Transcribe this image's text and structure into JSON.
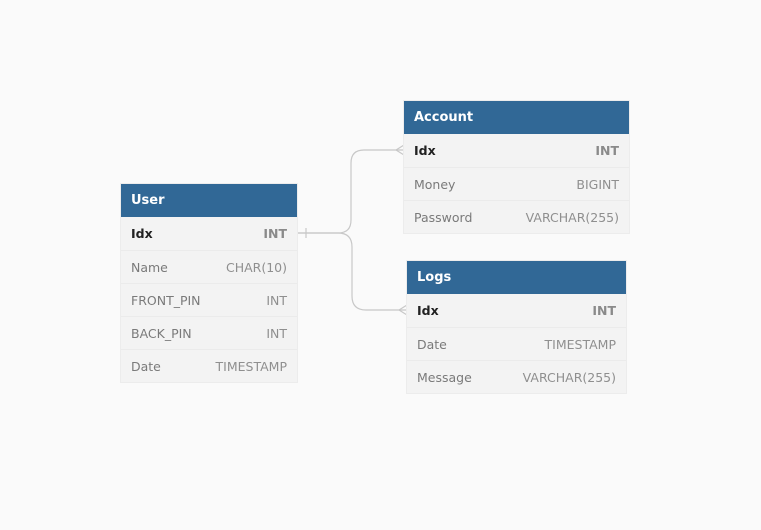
{
  "tables": [
    {
      "id": "user",
      "title": "User",
      "columns": [
        {
          "name": "Idx",
          "type": "INT",
          "pk": true
        },
        {
          "name": "Name",
          "type": "CHAR(10)",
          "pk": false
        },
        {
          "name": "FRONT_PIN",
          "type": "INT",
          "pk": false
        },
        {
          "name": "BACK_PIN",
          "type": "INT",
          "pk": false
        },
        {
          "name": "Date",
          "type": "TIMESTAMP",
          "pk": false
        }
      ]
    },
    {
      "id": "account",
      "title": "Account",
      "columns": [
        {
          "name": "Idx",
          "type": "INT",
          "pk": true
        },
        {
          "name": "Money",
          "type": "BIGINT",
          "pk": false
        },
        {
          "name": "Password",
          "type": "VARCHAR(255)",
          "pk": false
        }
      ]
    },
    {
      "id": "logs",
      "title": "Logs",
      "columns": [
        {
          "name": "Idx",
          "type": "INT",
          "pk": true
        },
        {
          "name": "Date",
          "type": "TIMESTAMP",
          "pk": false
        },
        {
          "name": "Message",
          "type": "VARCHAR(255)",
          "pk": false
        }
      ]
    }
  ],
  "relationships": [
    {
      "from": "user.Idx",
      "to": "account.Idx",
      "from_end": "one",
      "to_end": "many"
    },
    {
      "from": "user.Idx",
      "to": "logs.Idx",
      "from_end": "one",
      "to_end": "many"
    }
  ],
  "colors": {
    "header": "#316896",
    "background": "#fafafa",
    "connector": "#c8c8c8"
  }
}
